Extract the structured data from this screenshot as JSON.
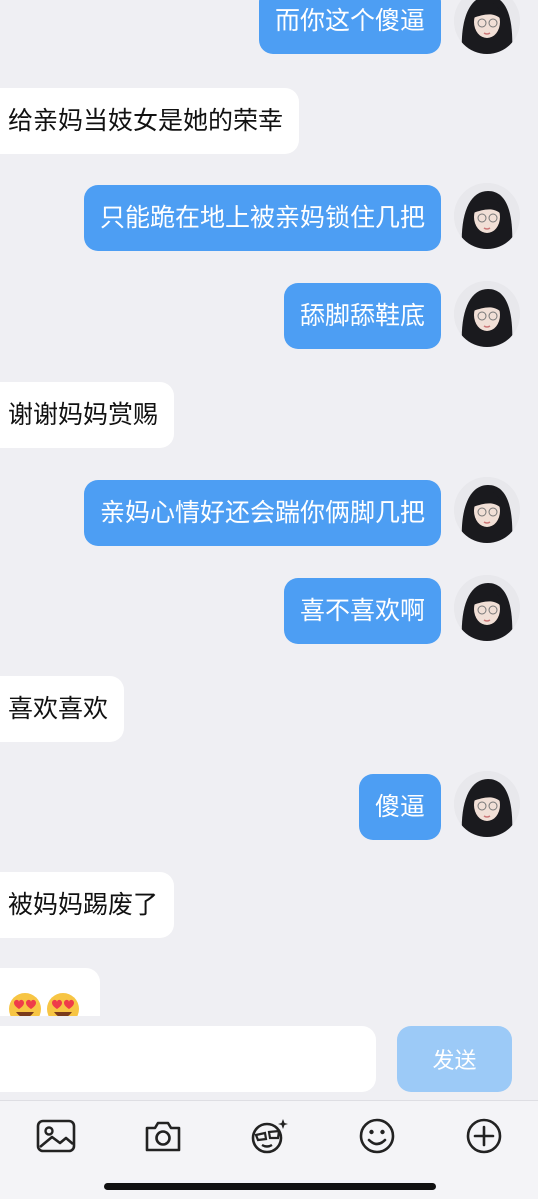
{
  "messages": [
    {
      "side": "out",
      "text": "而你这个傻逼"
    },
    {
      "side": "in",
      "text": "给亲妈当妓女是她的荣幸"
    },
    {
      "side": "out",
      "text": "只能跪在地上被亲妈锁住几把"
    },
    {
      "side": "out",
      "text": "舔脚舔鞋底"
    },
    {
      "side": "in",
      "text": "谢谢妈妈赏赐"
    },
    {
      "side": "out",
      "text": "亲妈心情好还会踹你俩脚几把"
    },
    {
      "side": "out",
      "text": "喜不喜欢啊"
    },
    {
      "side": "in",
      "text": "喜欢喜欢"
    },
    {
      "side": "out",
      "text": "傻逼"
    },
    {
      "side": "in",
      "text": "被妈妈踢废了"
    },
    {
      "side": "in",
      "text": "",
      "emoji": [
        "heart-eyes-emoji",
        "heart-eyes-emoji"
      ]
    }
  ],
  "input": {
    "placeholder": "",
    "value": ""
  },
  "send_button": {
    "label": "发送"
  },
  "toolbar": [
    "image-icon",
    "camera-icon",
    "sticker-icon",
    "emoji-icon",
    "add-icon"
  ],
  "colors": {
    "outgoing_bubble": "#4d9ef3",
    "incoming_bubble": "#ffffff",
    "send_disabled": "#9ccaf7",
    "background": "#efeff3"
  }
}
